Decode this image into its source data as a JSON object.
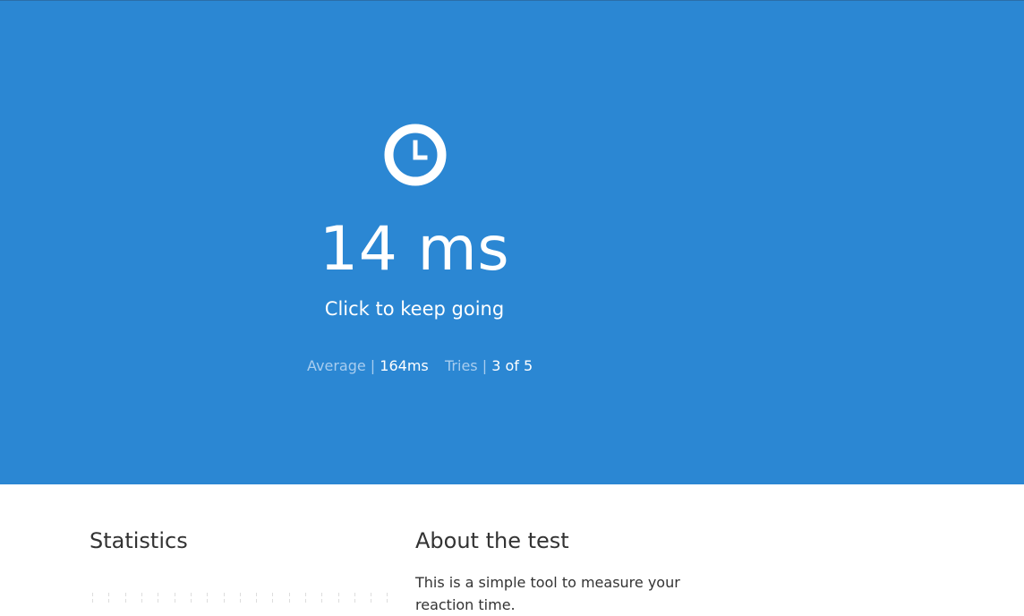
{
  "hero": {
    "icon": "clock-icon",
    "result": "14 ms",
    "prompt": "Click to keep going",
    "stats": {
      "average_label": "Average",
      "average_value": "164ms",
      "tries_label": "Tries",
      "tries_value": "3 of 5",
      "separator": "|"
    }
  },
  "statistics": {
    "heading": "Statistics"
  },
  "about": {
    "heading": "About the test",
    "text": "This is a simple tool to measure your reaction time."
  },
  "colors": {
    "hero_background": "#2b87d3",
    "accent_text": "#a8cdef",
    "body_text": "#333333"
  }
}
